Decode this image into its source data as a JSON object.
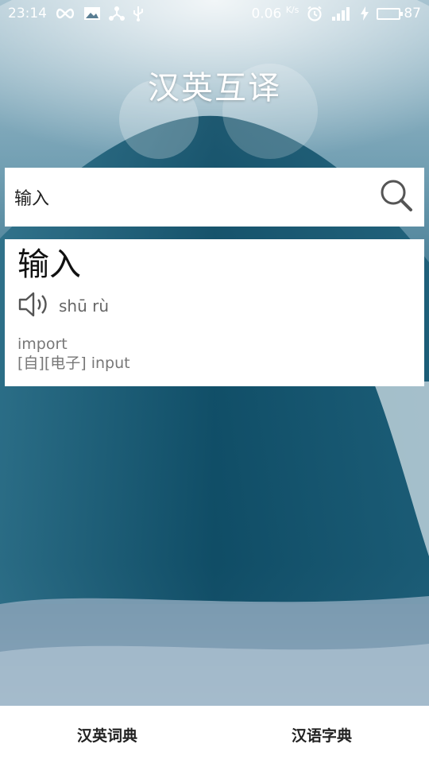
{
  "status_bar": {
    "time": "23:14",
    "net_speed": "0.06",
    "net_unit": "K/s",
    "battery_level": "87",
    "battery_fraction": 0.87,
    "battery_color": "#2bd14a",
    "icons": [
      "infinity-icon",
      "image-icon",
      "usb-share-icon",
      "usb-icon",
      "alarm-icon",
      "signal-icon",
      "charging-icon",
      "battery-icon"
    ]
  },
  "app": {
    "title": "汉英互译"
  },
  "search": {
    "value": "输入",
    "placeholder": "",
    "icon": "search-icon"
  },
  "result": {
    "word": "输入",
    "pinyin": "shū rù",
    "speaker_icon": "speaker-icon",
    "definitions": [
      "import",
      "[自][电子] input"
    ]
  },
  "bottom_nav": {
    "items": [
      {
        "label": "汉英词典"
      },
      {
        "label": "汉语字典"
      }
    ]
  }
}
